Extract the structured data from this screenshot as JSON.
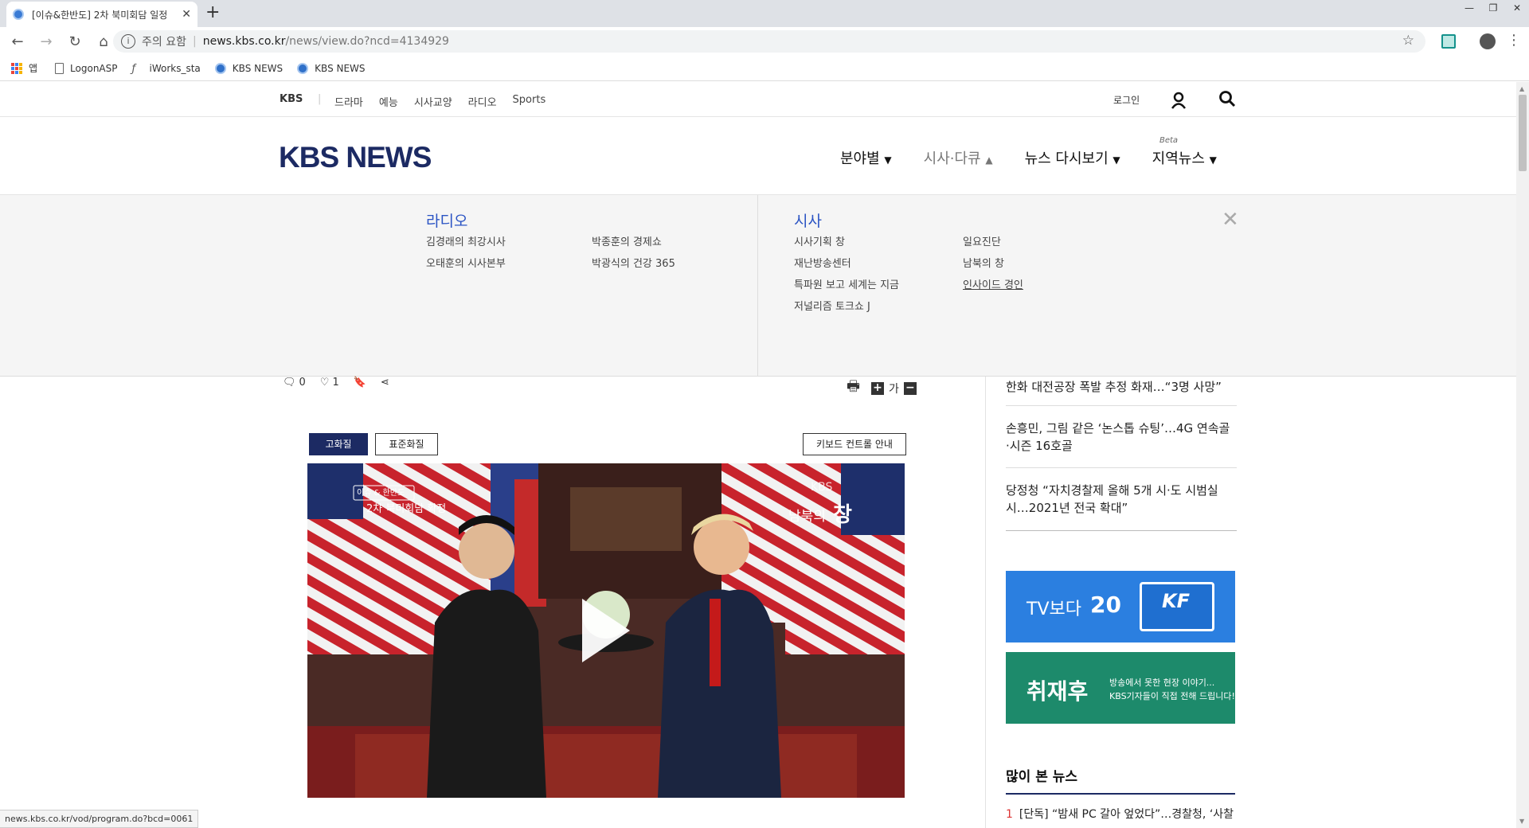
{
  "browser": {
    "tab_title": "[이슈&한반도] 2차 북미회담 일정",
    "address": {
      "warning": "주의 요함",
      "host": "news.kbs.co.kr",
      "path": "/news/view.do?ncd=4134929"
    },
    "bookmarks": [
      "앱",
      "LogonASP",
      "iWorks_sta",
      "KBS NEWS",
      "KBS NEWS"
    ],
    "status_url": "news.kbs.co.kr/vod/program.do?bcd=0061"
  },
  "site": {
    "topnav": {
      "brand": "KBS",
      "links": [
        "드라마",
        "예능",
        "시사교양",
        "라디오",
        "Sports"
      ],
      "login": "로그인"
    },
    "logo": "KBS NEWS",
    "mainnav": [
      {
        "label": "분야별",
        "arrow": "down",
        "active": false
      },
      {
        "label": "시사·다큐",
        "arrow": "up",
        "active": true
      },
      {
        "label": "뉴스 다시보기",
        "arrow": "down",
        "active": false
      },
      {
        "label": "지역뉴스",
        "arrow": "down",
        "active": false
      }
    ],
    "beta": "Beta",
    "dropdown": {
      "radio": {
        "title": "라디오",
        "items": [
          "김경래의 최강시사",
          "박종훈의 경제쇼",
          "오태훈의 시사본부",
          "박광식의 건강 365"
        ]
      },
      "sisa": {
        "title": "시사",
        "items": [
          "시사기획 창",
          "일요진단",
          "재난방송센터",
          "남북의 창",
          "특파원 보고 세계는 지금",
          "인사이드 경인",
          "저널리즘 토크쇼 J"
        ]
      }
    }
  },
  "article": {
    "comments": "0",
    "likes": "1",
    "font_label": "가",
    "quality_high": "고화질",
    "quality_std": "표준화질",
    "keyboard_help": "키보드 컨트롤 안내",
    "video": {
      "tag_top": "이슈 & 한반도",
      "tag_main": "2차 북미회담 확정",
      "program_logo": "남북의",
      "program_logo_char": "창",
      "watermark": "KBS"
    }
  },
  "sidebar": {
    "headlines": [
      "한화 대전공장 폭발 추정 화재…“3명 사망”",
      "손흥민, 그림 같은 ‘논스톱 슈팅’…4G 연속골 ·시즌 16호골",
      "당정청 “자치경찰제 올해 5개 시·도 시범실시…2021년 전국 확대”"
    ],
    "banner1": {
      "text1": "TV보다",
      "text2": "20",
      "badge": "KF"
    },
    "banner2": {
      "title": "취재후",
      "sub1": "방송에서 못한 현장 이야기...",
      "sub2": "KBS기자들이 직접 전해 드립니다!"
    },
    "popular_title": "많이 본 뉴스",
    "popular": [
      {
        "rank": "1",
        "title": "[단독] “밤새 PC 갈아 엎었다”…경찰청, ‘사찰"
      }
    ]
  }
}
